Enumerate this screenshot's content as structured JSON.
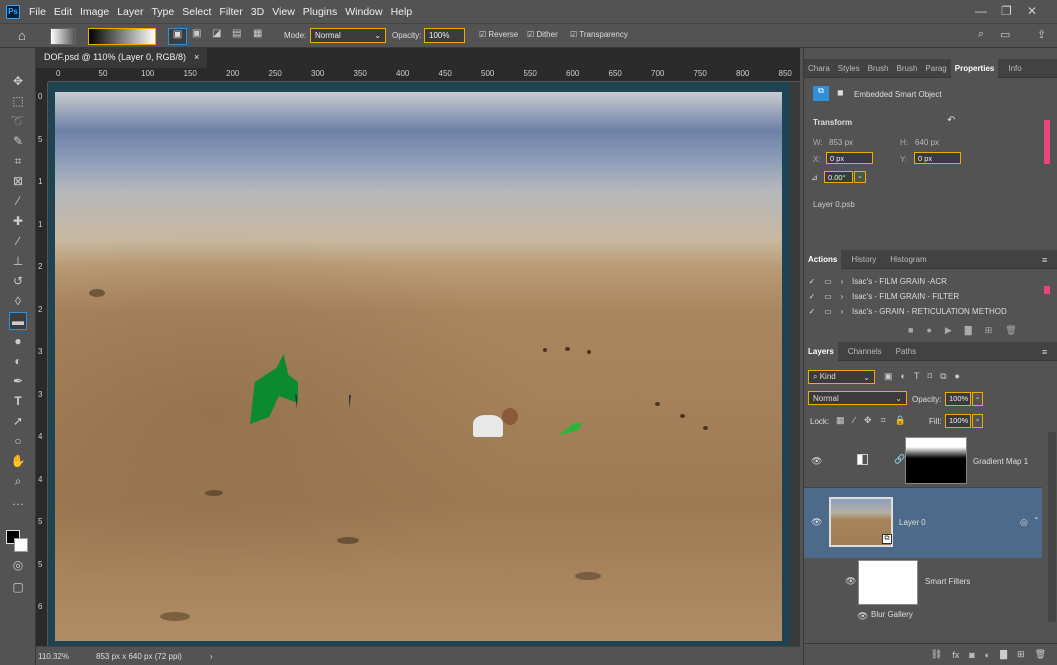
{
  "app": {
    "logo": "Ps"
  },
  "menu": [
    "File",
    "Edit",
    "Image",
    "Layer",
    "Type",
    "Select",
    "Filter",
    "3D",
    "View",
    "Plugins",
    "Window",
    "Help"
  ],
  "options": {
    "mode_label": "Mode:",
    "mode_value": "Normal",
    "opacity_label": "Opacity:",
    "opacity_value": "100%",
    "reverse": "Reverse",
    "dither": "Dither",
    "transparency": "Transparency"
  },
  "document": {
    "tab_title": "DOF.psd @ 110% (Layer 0, RGB/8)",
    "close": "×",
    "zoom": "110.32%",
    "dimensions": "853 px x 640 px (72 ppi)"
  },
  "ruler_h": [
    "0",
    "50",
    "100",
    "150",
    "200",
    "250",
    "300",
    "350",
    "400",
    "450",
    "500",
    "550",
    "600",
    "650",
    "700",
    "750",
    "800",
    "850"
  ],
  "ruler_v": [
    "0",
    "5",
    "1",
    "1",
    "2",
    "2",
    "3",
    "3",
    "4",
    "4",
    "5",
    "5",
    "6"
  ],
  "panel_top": {
    "tabs": [
      "Chara",
      "Styles",
      "Brush",
      "Brush",
      "Parag",
      "Properties",
      "Info"
    ],
    "active": "Properties",
    "type": "Embedded Smart Object",
    "section": "Transform",
    "w_label": "W:",
    "w_value": "853 px",
    "h_label": "H:",
    "h_value": "640 px",
    "x_label": "X:",
    "x_value": "0 px",
    "y_label": "Y:",
    "y_value": "0 px",
    "angle_value": "0.00°",
    "file": "Layer 0.psb"
  },
  "panel_actions": {
    "tabs": [
      "Actions",
      "History",
      "Histogram"
    ],
    "active": "Actions",
    "items": [
      "Isac's - FILM GRAIN -ACR",
      "Isac's - FILM GRAIN - FILTER",
      "Isac's - GRAIN - RETICULATION  METHOD"
    ]
  },
  "panel_layers": {
    "tabs": [
      "Layers",
      "Channels",
      "Paths"
    ],
    "active": "Layers",
    "filter": "Kind",
    "blend": "Normal",
    "opacity_label": "Opacity:",
    "opacity_value": "100%",
    "lock_label": "Lock:",
    "fill_label": "Fill:",
    "fill_value": "100%",
    "layers": [
      {
        "name": "Gradient Map 1"
      },
      {
        "name": "Layer 0"
      },
      {
        "name": "Smart Filters"
      },
      {
        "name": "Blur Gallery"
      }
    ]
  },
  "colors": {
    "accent": "#2f8fd9",
    "selected_layer": "#4d6a8a",
    "highlight": "#f2a900"
  }
}
